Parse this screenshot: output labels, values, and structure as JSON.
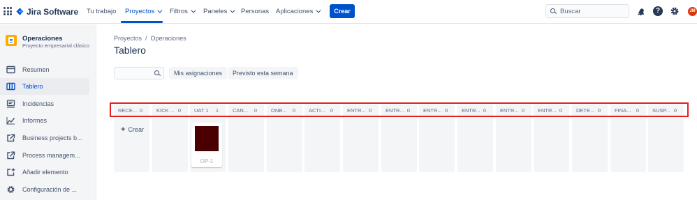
{
  "topnav": {
    "logo_text": "Jira Software",
    "items": [
      {
        "label": "Tu trabajo",
        "dropdown": false,
        "active": false
      },
      {
        "label": "Proyectos",
        "dropdown": true,
        "active": true
      },
      {
        "label": "Filtros",
        "dropdown": true,
        "active": false
      },
      {
        "label": "Paneles",
        "dropdown": true,
        "active": false
      },
      {
        "label": "Personas",
        "dropdown": false,
        "active": false
      },
      {
        "label": "Aplicaciones",
        "dropdown": true,
        "active": false
      }
    ],
    "create_label": "Crear",
    "search_placeholder": "Buscar",
    "avatar_initials": "JM",
    "accent": "#0052cc"
  },
  "sidebar": {
    "project_name": "Operaciones",
    "project_type": "Proyecto empresarial clásico",
    "items": [
      {
        "label": "Resumen",
        "icon": "summary-icon",
        "active": false
      },
      {
        "label": "Tablero",
        "icon": "board-icon",
        "active": true
      },
      {
        "label": "Incidencias",
        "icon": "issues-icon",
        "active": false
      },
      {
        "label": "Informes",
        "icon": "reports-icon",
        "active": false
      },
      {
        "label": "Business projects b...",
        "icon": "external-link-icon",
        "active": false
      },
      {
        "label": "Process managem...",
        "icon": "external-link-icon",
        "active": false
      },
      {
        "label": "Añadir elemento",
        "icon": "add-item-icon",
        "active": false
      },
      {
        "label": "Configuración de ...",
        "icon": "gear-icon",
        "active": false
      }
    ]
  },
  "main": {
    "breadcrumb": [
      "Proyectos",
      "Operaciones"
    ],
    "breadcrumb_sep": "/",
    "title": "Tablero",
    "quick_filters": [
      "Mis asignaciones",
      "Previsto esta semana"
    ],
    "columns": [
      {
        "name": "RECE...",
        "count": "0"
      },
      {
        "name": "KICK ...",
        "count": "0"
      },
      {
        "name": "UAT 1",
        "count": "1"
      },
      {
        "name": "CAN...",
        "count": "0"
      },
      {
        "name": "ONB...",
        "count": "0"
      },
      {
        "name": "ACTI...",
        "count": "0"
      },
      {
        "name": "ENTR...",
        "count": "0"
      },
      {
        "name": "ENTR...",
        "count": "0"
      },
      {
        "name": "ENTR...",
        "count": "0"
      },
      {
        "name": "ENTR...",
        "count": "0"
      },
      {
        "name": "ENTR...",
        "count": "0"
      },
      {
        "name": "ENTR...",
        "count": "0"
      },
      {
        "name": "DETE...",
        "count": "0"
      },
      {
        "name": "FINA...",
        "count": "0"
      },
      {
        "name": "SUSP...",
        "count": "0"
      }
    ],
    "create_issue_label": "Crear",
    "card_key": "OP-1",
    "highlight_color": "#e61e1e"
  }
}
